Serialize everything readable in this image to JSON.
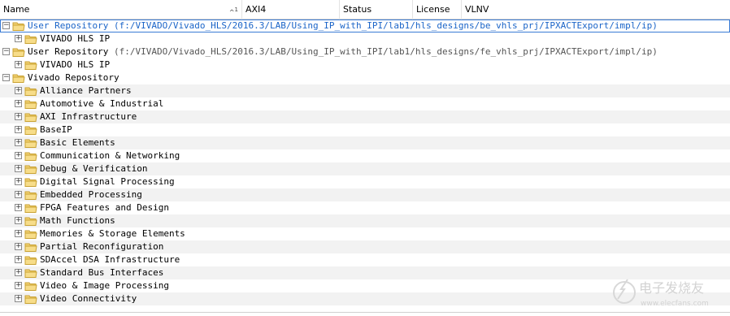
{
  "header": {
    "columns": [
      "Name",
      "AXI4",
      "Status",
      "License",
      "VLNV"
    ],
    "sort_indicator": "1"
  },
  "rows": [
    {
      "label": "User Repository",
      "path": "(f:/VIVADO/Vivado_HLS/2016.3/LAB/Using_IP_with_IPI/lab1/hls_designs/be_vhls_prj/IPXACTExport/impl/ip)",
      "level": 0,
      "expander": "−",
      "selected": true,
      "alt": false
    },
    {
      "label": "VIVADO HLS IP",
      "path": "",
      "level": 1,
      "expander": "+",
      "selected": false,
      "alt": false
    },
    {
      "label": "User Repository",
      "path": "(f:/VIVADO/Vivado_HLS/2016.3/LAB/Using_IP_with_IPI/lab1/hls_designs/fe_vhls_prj/IPXACTExport/impl/ip)",
      "level": 0,
      "expander": "−",
      "selected": false,
      "alt": false
    },
    {
      "label": "VIVADO HLS IP",
      "path": "",
      "level": 1,
      "expander": "+",
      "selected": false,
      "alt": false
    },
    {
      "label": "Vivado Repository",
      "path": "",
      "level": 0,
      "expander": "−",
      "selected": false,
      "alt": false
    },
    {
      "label": "Alliance Partners",
      "path": "",
      "level": 1,
      "expander": "+",
      "selected": false,
      "alt": true
    },
    {
      "label": "Automotive & Industrial",
      "path": "",
      "level": 1,
      "expander": "+",
      "selected": false,
      "alt": false
    },
    {
      "label": "AXI Infrastructure",
      "path": "",
      "level": 1,
      "expander": "+",
      "selected": false,
      "alt": true
    },
    {
      "label": "BaseIP",
      "path": "",
      "level": 1,
      "expander": "+",
      "selected": false,
      "alt": false
    },
    {
      "label": "Basic Elements",
      "path": "",
      "level": 1,
      "expander": "+",
      "selected": false,
      "alt": true
    },
    {
      "label": "Communication & Networking",
      "path": "",
      "level": 1,
      "expander": "+",
      "selected": false,
      "alt": false
    },
    {
      "label": "Debug & Verification",
      "path": "",
      "level": 1,
      "expander": "+",
      "selected": false,
      "alt": true
    },
    {
      "label": "Digital Signal Processing",
      "path": "",
      "level": 1,
      "expander": "+",
      "selected": false,
      "alt": false
    },
    {
      "label": "Embedded Processing",
      "path": "",
      "level": 1,
      "expander": "+",
      "selected": false,
      "alt": true
    },
    {
      "label": "FPGA Features and Design",
      "path": "",
      "level": 1,
      "expander": "+",
      "selected": false,
      "alt": false
    },
    {
      "label": "Math Functions",
      "path": "",
      "level": 1,
      "expander": "+",
      "selected": false,
      "alt": true
    },
    {
      "label": "Memories & Storage Elements",
      "path": "",
      "level": 1,
      "expander": "+",
      "selected": false,
      "alt": false
    },
    {
      "label": "Partial Reconfiguration",
      "path": "",
      "level": 1,
      "expander": "+",
      "selected": false,
      "alt": true
    },
    {
      "label": "SDAccel DSA Infrastructure",
      "path": "",
      "level": 1,
      "expander": "+",
      "selected": false,
      "alt": false
    },
    {
      "label": "Standard Bus Interfaces",
      "path": "",
      "level": 1,
      "expander": "+",
      "selected": false,
      "alt": true
    },
    {
      "label": "Video & Image Processing",
      "path": "",
      "level": 1,
      "expander": "+",
      "selected": false,
      "alt": false
    },
    {
      "label": "Video Connectivity",
      "path": "",
      "level": 1,
      "expander": "+",
      "selected": false,
      "alt": true
    }
  ],
  "watermark": {
    "text": "电子发烧友",
    "url_text": "www.elecfans.com"
  },
  "colors": {
    "folder_fill": "#f2d173",
    "folder_stroke": "#c9a233",
    "selection_border": "#3a7bd5",
    "selected_text": "#1a64c8"
  },
  "icons": {
    "folder": "folder-icon",
    "expand": "plus-expander-icon",
    "collapse": "minus-expander-icon"
  }
}
